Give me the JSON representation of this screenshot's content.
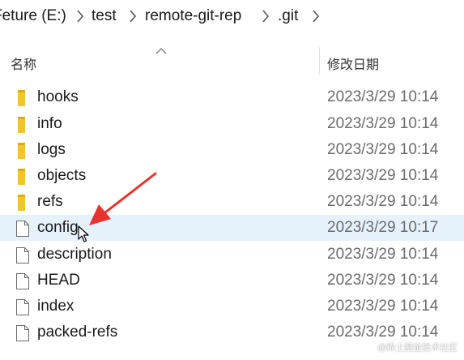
{
  "breadcrumb": {
    "items": [
      "Feture (E:)",
      "test",
      "remote-git-rep",
      ".git"
    ]
  },
  "columns": {
    "name_header": "名称",
    "date_header": "修改日期"
  },
  "rows": [
    {
      "type": "folder",
      "icon": "folder-icon",
      "name": "hooks",
      "modified": "2023/3/29 10:14"
    },
    {
      "type": "folder",
      "icon": "folder-icon",
      "name": "info",
      "modified": "2023/3/29 10:14"
    },
    {
      "type": "folder",
      "icon": "folder-icon",
      "name": "logs",
      "modified": "2023/3/29 10:14"
    },
    {
      "type": "folder",
      "icon": "folder-icon",
      "name": "objects",
      "modified": "2023/3/29 10:14"
    },
    {
      "type": "folder",
      "icon": "folder-icon",
      "name": "refs",
      "modified": "2023/3/29 10:14"
    },
    {
      "type": "file",
      "icon": "file-icon",
      "name": "config",
      "modified": "2023/3/29 10:17",
      "selected": true
    },
    {
      "type": "file",
      "icon": "file-icon",
      "name": "description",
      "modified": "2023/3/29 10:14"
    },
    {
      "type": "file",
      "icon": "file-icon",
      "name": "HEAD",
      "modified": "2023/3/29 10:14"
    },
    {
      "type": "file",
      "icon": "file-icon",
      "name": "index",
      "modified": "2023/3/29 10:14"
    },
    {
      "type": "file",
      "icon": "file-icon",
      "name": "packed-refs",
      "modified": "2023/3/29 10:14"
    }
  ],
  "watermark": "@稀土掘金技术社区",
  "colors": {
    "folder": "#f4c430",
    "selection": "#e5f1fb",
    "annotation_arrow": "#e8322e"
  }
}
